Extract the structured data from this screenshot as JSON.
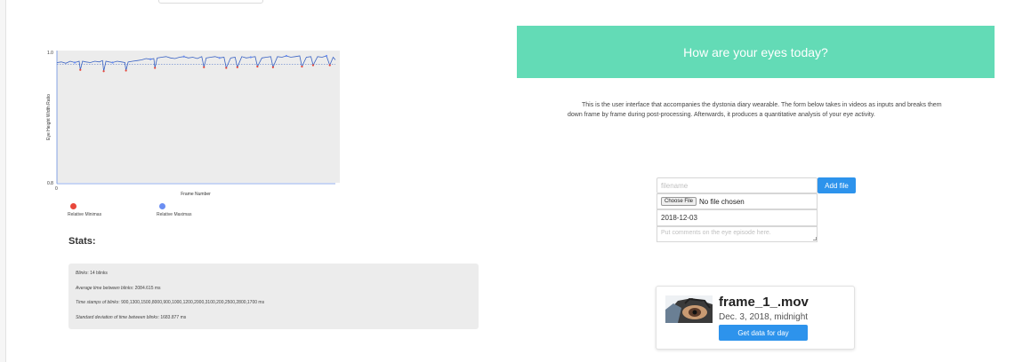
{
  "chart_data": {
    "type": "line",
    "title": "",
    "xlabel": "Frame Number",
    "ylabel": "Eye Height Width Ratio",
    "ylim": [
      0.8,
      1.0
    ],
    "y_ticks": [
      "1.0",
      "0.8"
    ],
    "x_ticks": [
      "0"
    ],
    "x_range": [
      0,
      2500
    ],
    "grid": false,
    "legend_position": "bottom-left",
    "threshold": 0.979,
    "series": [
      {
        "name": "",
        "x": [
          0,
          40,
          80,
          120,
          160,
          180,
          200,
          210,
          230,
          260,
          300,
          340,
          380,
          410,
          420,
          440,
          470,
          500,
          540,
          580,
          610,
          620,
          640,
          680,
          720,
          760,
          800,
          840,
          870,
          880,
          900,
          940,
          980,
          1020,
          1060,
          1100,
          1140,
          1180,
          1220,
          1260,
          1300,
          1320,
          1340,
          1380,
          1420,
          1460,
          1500,
          1520,
          1560,
          1600,
          1620,
          1660,
          1700,
          1740,
          1780,
          1800,
          1840,
          1880,
          1920,
          1940,
          1980,
          2020,
          2060,
          2100,
          2140,
          2180,
          2200,
          2240,
          2280,
          2300,
          2340,
          2380,
          2420,
          2450,
          2480,
          2500
        ],
        "y": [
          0.982,
          0.983,
          0.981,
          0.984,
          0.982,
          0.983,
          0.984,
          0.971,
          0.984,
          0.983,
          0.982,
          0.984,
          0.983,
          0.985,
          0.969,
          0.984,
          0.983,
          0.982,
          0.984,
          0.983,
          0.982,
          0.97,
          0.983,
          0.984,
          0.985,
          0.986,
          0.988,
          0.987,
          0.988,
          0.974,
          0.989,
          0.99,
          0.991,
          0.989,
          0.988,
          0.99,
          0.991,
          0.989,
          0.99,
          0.988,
          0.991,
          0.975,
          0.989,
          0.99,
          0.991,
          0.989,
          0.99,
          0.974,
          0.989,
          0.99,
          0.975,
          0.991,
          0.989,
          0.99,
          0.991,
          0.976,
          0.989,
          0.99,
          0.991,
          0.975,
          0.991,
          0.99,
          0.992,
          0.99,
          0.991,
          0.992,
          0.976,
          0.99,
          0.991,
          0.978,
          0.991,
          0.99,
          0.992,
          0.978,
          0.99,
          0.986
        ]
      },
      {
        "name": "Relative Minimas",
        "x": [
          210,
          420,
          620,
          880,
          1320,
          1520,
          1620,
          1800,
          1940,
          2200,
          2300,
          2450
        ],
        "y": [
          0.971,
          0.969,
          0.97,
          0.974,
          0.975,
          0.974,
          0.975,
          0.976,
          0.975,
          0.976,
          0.978,
          0.978
        ]
      },
      {
        "name": "Relative Maximas",
        "x": [
          160,
          500,
          840,
          1140,
          1460,
          1740,
          2060,
          2420
        ],
        "y": [
          0.982,
          0.982,
          0.987,
          0.991,
          0.989,
          0.99,
          0.992,
          0.992
        ]
      }
    ]
  },
  "legend": {
    "minima_label": "Relative Minimas",
    "maxima_label": "Relative Maximas",
    "minima_color": "#e8473b",
    "maxima_color": "#6b8ef2",
    "line_color": "#3a63c4"
  },
  "stats": {
    "heading": "Stats:",
    "blinks_label": "Blinks",
    "blinks_value": ": 14 blinks",
    "avg_label": "Average time between blinks",
    "avg_value": ": 2084.615 ms",
    "timestamps_label": "Time stamps of blinks",
    "timestamps_value": ": 900,1300,1500,8000,900,1000,1200,2000,3100,200,2500,2800,1700 ms",
    "std_label": "Standard deviation of time between blinks",
    "std_value": ": 1683.877 ms"
  },
  "banner": {
    "title": "How are your eyes today?",
    "color": "#63dbb6"
  },
  "intro": {
    "text": "This is the user interface that accompanies the dystonia diary wearable. The form below takes in videos as inputs and breaks them down frame by frame during post-processing. Afterwards, it produces a quantitative analysis of your eye activity."
  },
  "form": {
    "filename_placeholder": "filename",
    "add_file_label": "Add file",
    "choose_file_label": "Choose File",
    "no_file_text": "No file chosen",
    "date_value": "2018-12-03",
    "comment_placeholder": "Put comments on the eye episode here."
  },
  "card": {
    "title": "frame_1_.mov",
    "date": "Dec. 3, 2018, midnight",
    "button_label": "Get data for day",
    "thumbnail_icon": "eye-video-thumbnail-icon"
  },
  "accent_color": "#2d93ec"
}
